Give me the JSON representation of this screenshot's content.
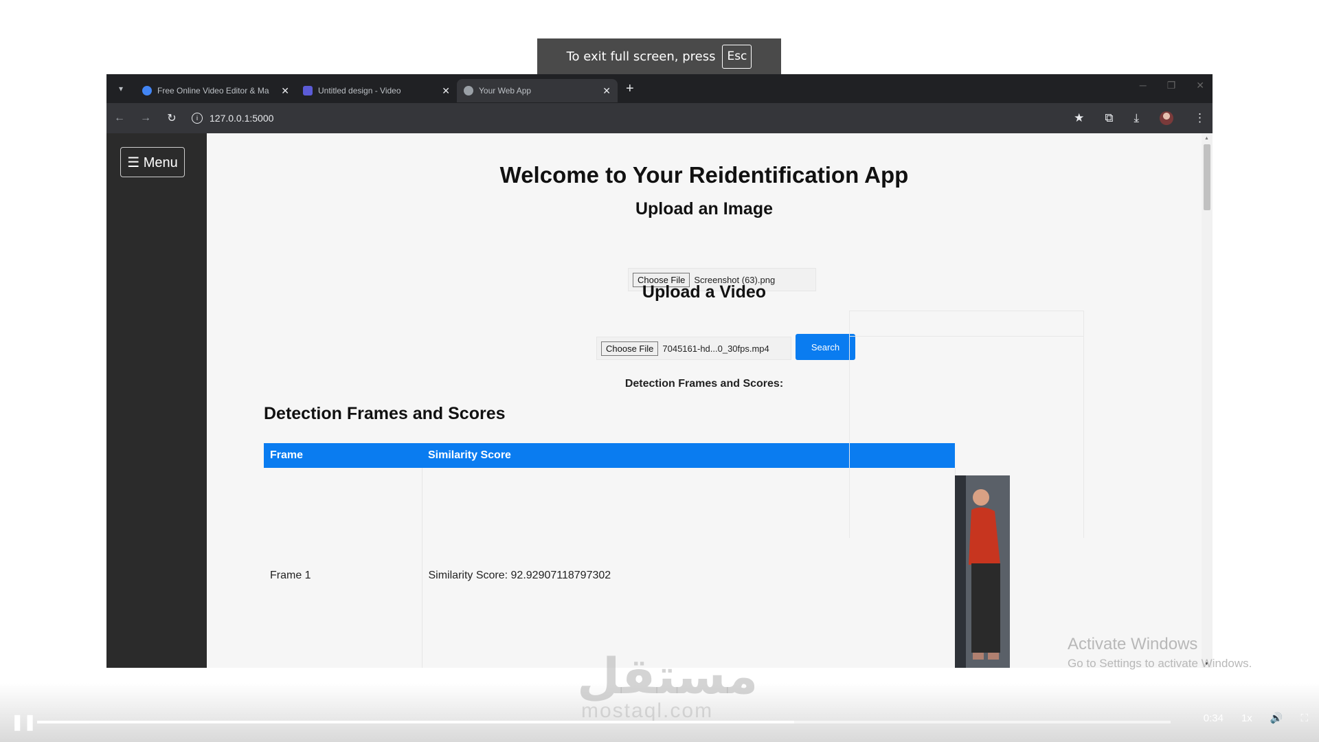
{
  "fullscreen_notice": {
    "text": "To exit full screen, press",
    "key": "Esc"
  },
  "browser": {
    "tabs": [
      {
        "title": "Free Online Video Editor & Ma",
        "color": "#4285f4"
      },
      {
        "title": "Untitled design - Video",
        "color": "#5b5bd6"
      },
      {
        "title": "Your Web App",
        "color": "#9aa0a6"
      }
    ],
    "url": "127.0.0.1:5000"
  },
  "app": {
    "menu_label": "☰ Menu",
    "title": "Welcome to Your Reidentification App",
    "upload_image_heading": "Upload an Image",
    "image_choose_label": "Choose File",
    "image_file_name": "Screenshot (63).png",
    "upload_video_heading": "Upload a Video",
    "video_choose_label": "Choose File",
    "video_file_name": "7045161-hd...0_30fps.mp4",
    "search_label": "Search",
    "detection_subheading": "Detection Frames and Scores:",
    "detection_heading": "Detection Frames and Scores",
    "table": {
      "headers": [
        "Frame",
        "Similarity Score"
      ],
      "rows": [
        {
          "frame": "Frame 1",
          "score": "Similarity Score: 92.92907118797302"
        }
      ]
    }
  },
  "activate_windows": {
    "title": "Activate Windows",
    "subtitle": "Go to Settings to activate Windows."
  },
  "player": {
    "watermark": "مستقل",
    "watermark_sub": "mostaql.com",
    "time": "0:34",
    "speed": "1x",
    "progress_percent": 4.6,
    "buffered_percent": 66.8
  }
}
